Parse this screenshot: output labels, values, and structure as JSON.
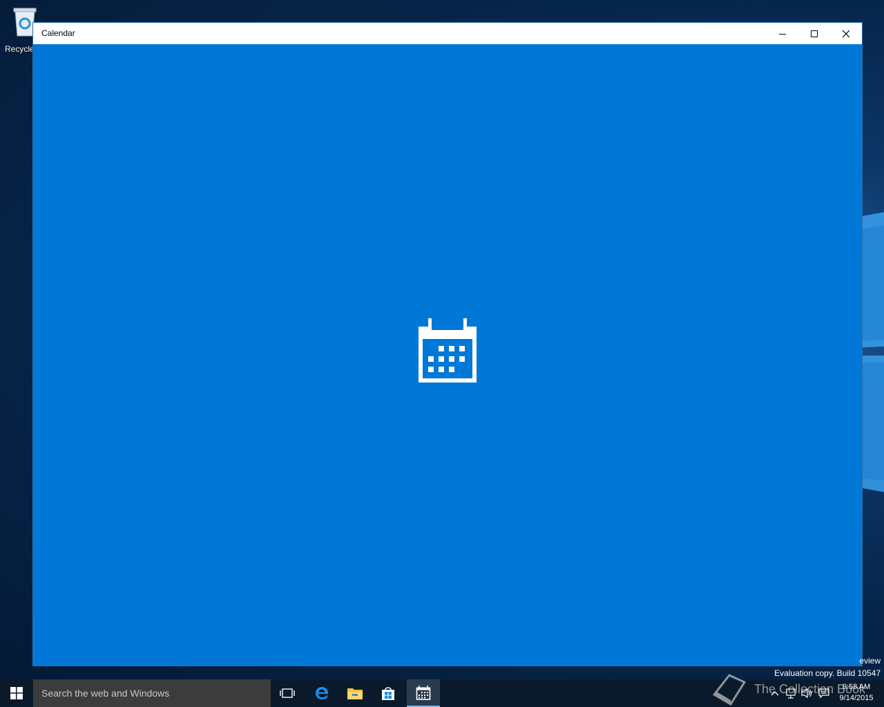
{
  "desktop": {
    "recycle_bin_label": "Recycle"
  },
  "window": {
    "title": "Calendar",
    "background": "#0078d7",
    "splash_icon": "calendar-icon"
  },
  "watermark": {
    "edition_fragment": "eview",
    "build_text": "Evaluation copy. Build 10547"
  },
  "taskbar": {
    "search_placeholder": "Search the web and Windows",
    "apps": [
      {
        "name": "task-view-icon"
      },
      {
        "name": "edge-icon"
      },
      {
        "name": "file-explorer-icon"
      },
      {
        "name": "store-icon"
      },
      {
        "name": "calendar-icon",
        "active": true
      }
    ],
    "clock": {
      "time": "9:58 AM",
      "date": "9/14/2015"
    },
    "overlay_text": "The Collection Book"
  }
}
